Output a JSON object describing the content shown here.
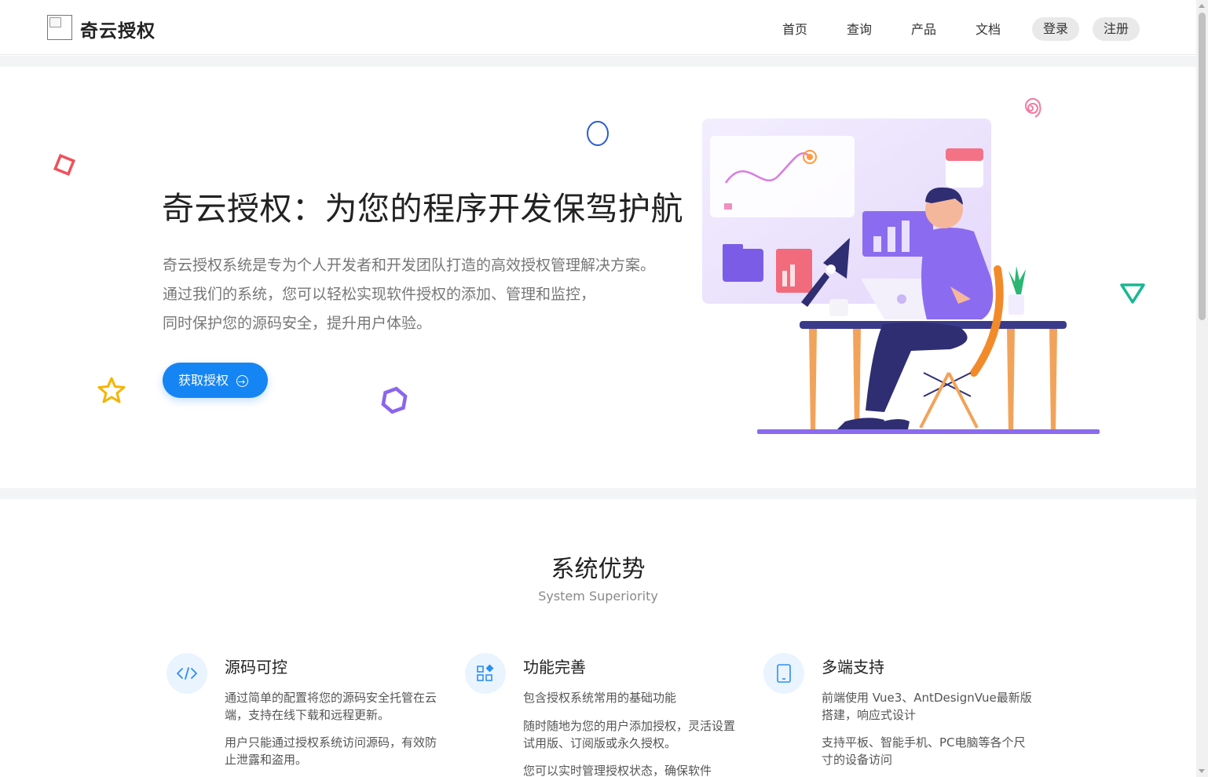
{
  "header": {
    "logo_text": "奇云授权",
    "nav": [
      "首页",
      "查询",
      "产品",
      "文档"
    ],
    "login": "登录",
    "register": "注册"
  },
  "hero": {
    "title": "奇云授权：为您的程序开发保驾护航",
    "desc": [
      "奇云授权系统是专为个人开发者和开发团队打造的高效授权管理解决方案。",
      "通过我们的系统，您可以轻松实现软件授权的添加、管理和监控，",
      "同时保护您的源码安全，提升用户体验。"
    ],
    "cta": "获取授权"
  },
  "section": {
    "title": "系统优势",
    "subtitle": "System Superiority"
  },
  "features": [
    {
      "icon": "code-icon",
      "title": "源码可控",
      "paras": [
        "通过简单的配置将您的源码安全托管在云端，支持在线下载和远程更新。",
        "用户只能通过授权系统访问源码，有效防止泄露和盗用。"
      ]
    },
    {
      "icon": "apps-icon",
      "title": "功能完善",
      "paras": [
        "包含授权系统常用的基础功能",
        "随时随地为您的用户添加授权，灵活设置试用版、订阅版或永久授权。",
        "您可以实时管理授权状态，确保软件"
      ]
    },
    {
      "icon": "tablet-icon",
      "title": "多端支持",
      "paras": [
        "前端使用 Vue3、AntDesignVue最新版搭建，响应式设计",
        "支持平板、智能手机、PC电脑等各个尺寸的设备访问"
      ]
    }
  ],
  "colors": {
    "accent": "#1685f4",
    "illustration_purple": "#8b6cf0",
    "desk": "#2f2e72"
  }
}
